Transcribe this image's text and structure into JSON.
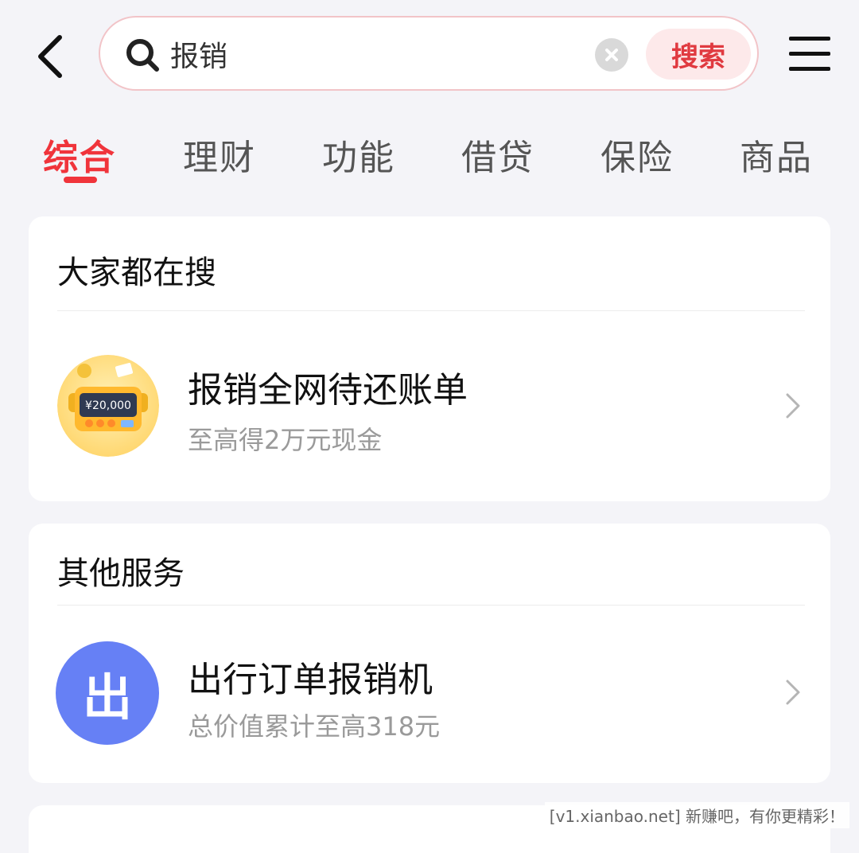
{
  "search": {
    "value": "报销",
    "button_label": "搜索"
  },
  "tabs": [
    {
      "label": "综合",
      "active": true
    },
    {
      "label": "理财",
      "active": false
    },
    {
      "label": "功能",
      "active": false
    },
    {
      "label": "借贷",
      "active": false
    },
    {
      "label": "保险",
      "active": false
    },
    {
      "label": "商品",
      "active": false
    }
  ],
  "popular": {
    "title": "大家都在搜",
    "items": [
      {
        "title": "报销全网待还账单",
        "subtitle": "至高得2万元现金",
        "amount": "¥20,000"
      }
    ]
  },
  "services": {
    "title": "其他服务",
    "items": [
      {
        "title": "出行订单报销机",
        "subtitle": "总价值累计至高318元",
        "icon_char": "出"
      }
    ]
  },
  "watermark": "[v1.xianbao.net] 新赚吧，有你更精彩！",
  "colors": {
    "accent": "#f0343b",
    "service_icon": "#6680f5",
    "background": "#f4f4f8"
  },
  "icons": [
    "back-arrow-icon",
    "search-icon",
    "clear-icon",
    "menu-icon",
    "chevron-right-icon"
  ]
}
